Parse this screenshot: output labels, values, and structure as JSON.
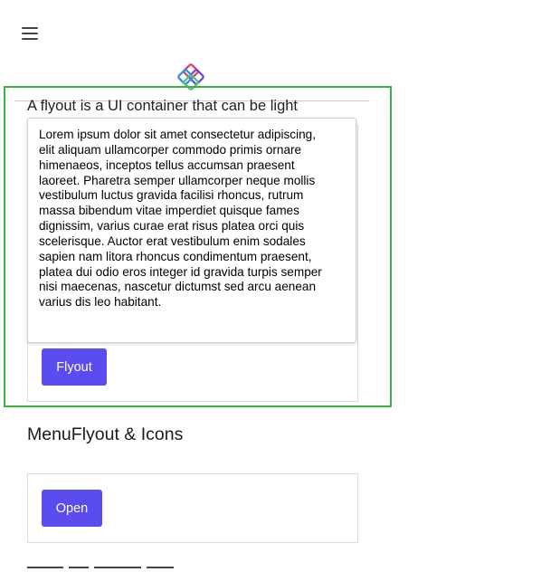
{
  "nav": {
    "menu_icon": "hamburger-icon",
    "logo_icon": "app-logo-icon"
  },
  "flyout_section": {
    "description_partial": "A flyout is a UI container that can be light",
    "button_label": "Flyout"
  },
  "flyout_popup": {
    "text": " Lorem ipsum dolor sit amet consectetur adipiscing,\nelit aliquam ullamcorper commodo primis ornare\nhimenaeos, inceptos tellus accumsan praesent\nlaoreet. Pharetra semper ullamcorper neque mollis\nvestibulum luctus gravida facilisi rhoncus, rutrum\nmassa bibendum vitae imperdiet quisque fames\ndignissim, varius curae erat risus platea orci quis\nscelerisque. Auctor erat vestibulum enim sodales\nsapien nam litora rhoncus condimentum praesent,\nplatea dui odio eros integer id gravida turpis semper\nnisi maecenas, nascetur dictumst sed arcu aenean\nvarius dis leo habitant."
  },
  "menuflyout_section": {
    "title": "MenuFlyout & Icons",
    "button_label": "Open"
  },
  "colors": {
    "accent": "#5b4cf0",
    "highlight_border": "#3cb43c",
    "card_border": "#dcdcdc"
  }
}
